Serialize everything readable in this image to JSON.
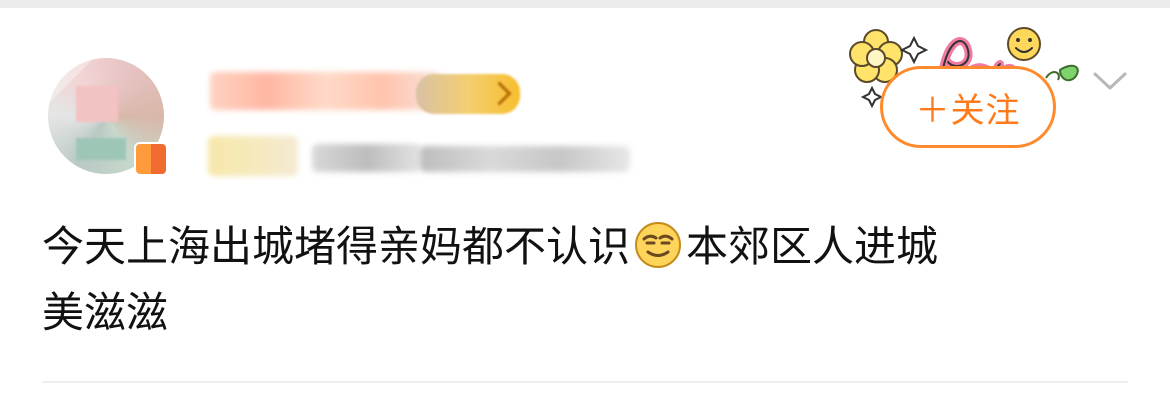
{
  "post": {
    "line_1_part_1": "今天上海出城堵得亲妈都不认识",
    "emoji": "smirk-emoji",
    "line_1_part_2": "本郊区人进城",
    "line_2": "美滋滋"
  },
  "actions": {
    "follow_label": "＋关注"
  },
  "icons": {
    "menu": "chevron-down-icon",
    "avatar_badge": "badge-icon",
    "decoration": "flower-smiley-decoration"
  },
  "colors": {
    "accent": "#ff7a1a",
    "text": "#111111",
    "divider": "#eeeeee"
  }
}
